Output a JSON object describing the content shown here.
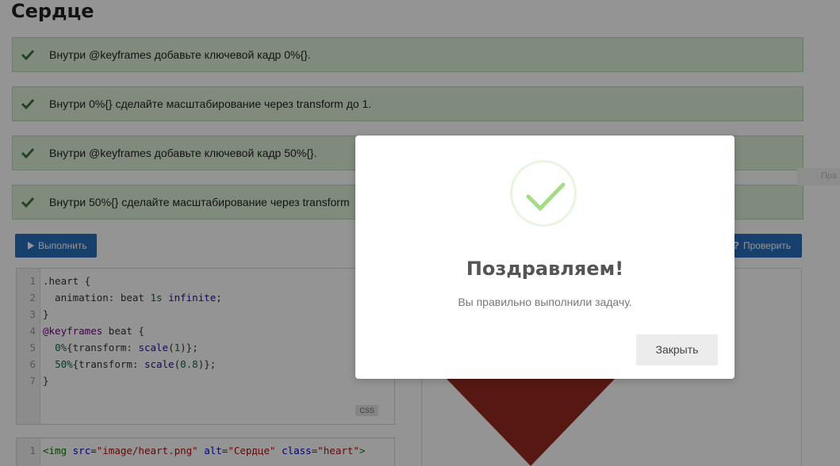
{
  "page": {
    "title": "Сердце"
  },
  "tasks": [
    {
      "text": "Внутри @keyframes добавьте ключевой кадр 0%{}.",
      "status": "done"
    },
    {
      "text": "Внутри 0%{} сделайте масштабирование через transform до 1.",
      "status": "done"
    },
    {
      "text": "Внутри @keyframes добавьте ключевой кадр 50%{}.",
      "status": "done"
    },
    {
      "text": "Внутри 50%{} сделайте масштабирование через transform",
      "status": "done"
    }
  ],
  "toolbar": {
    "run_label": "Выполнить",
    "check_label": "Проверить",
    "check_icon": "?"
  },
  "css_editor": {
    "badge": "CSS",
    "line_numbers": [
      "1",
      "2",
      "3",
      "4",
      "5",
      "6",
      "7"
    ],
    "lines": {
      "l1": ".heart {",
      "l2_prop": "  animation: beat ",
      "l2_num": "1s",
      "l2_atom": "infinite",
      "l2_end": ";",
      "l3": "}",
      "l4_kw": "@keyframes",
      "l4_rest": " beat {",
      "l5_num": "0%",
      "l5_a": "{transform: ",
      "l5_fn": "scale",
      "l5_b": "(",
      "l5_val": "1",
      "l5_c": ")};",
      "l6_num": "50%",
      "l6_a": "{transform: ",
      "l6_fn": "scale",
      "l6_b": "(",
      "l6_val": "0.8",
      "l6_c": ")};",
      "l7": "}"
    }
  },
  "html_editor": {
    "line_number": "1",
    "tag_open": "<img",
    "attr_src": "src",
    "val_src": "\"image/heart.png\"",
    "attr_alt": "alt",
    "val_alt": "\"Сердце\"",
    "attr_class": "class",
    "val_class": "\"heart\"",
    "tag_close": ">"
  },
  "side_tab": {
    "label": "Пра"
  },
  "modal": {
    "title": "Поздравляем!",
    "text": "Вы правильно выполнили задачу.",
    "close_label": "Закрыть"
  },
  "colors": {
    "task_bg": "#dff0d8",
    "check": "#3c763d",
    "button_primary": "#2a6ebb",
    "success_check": "#a5dc86",
    "heart": "#962a22"
  }
}
